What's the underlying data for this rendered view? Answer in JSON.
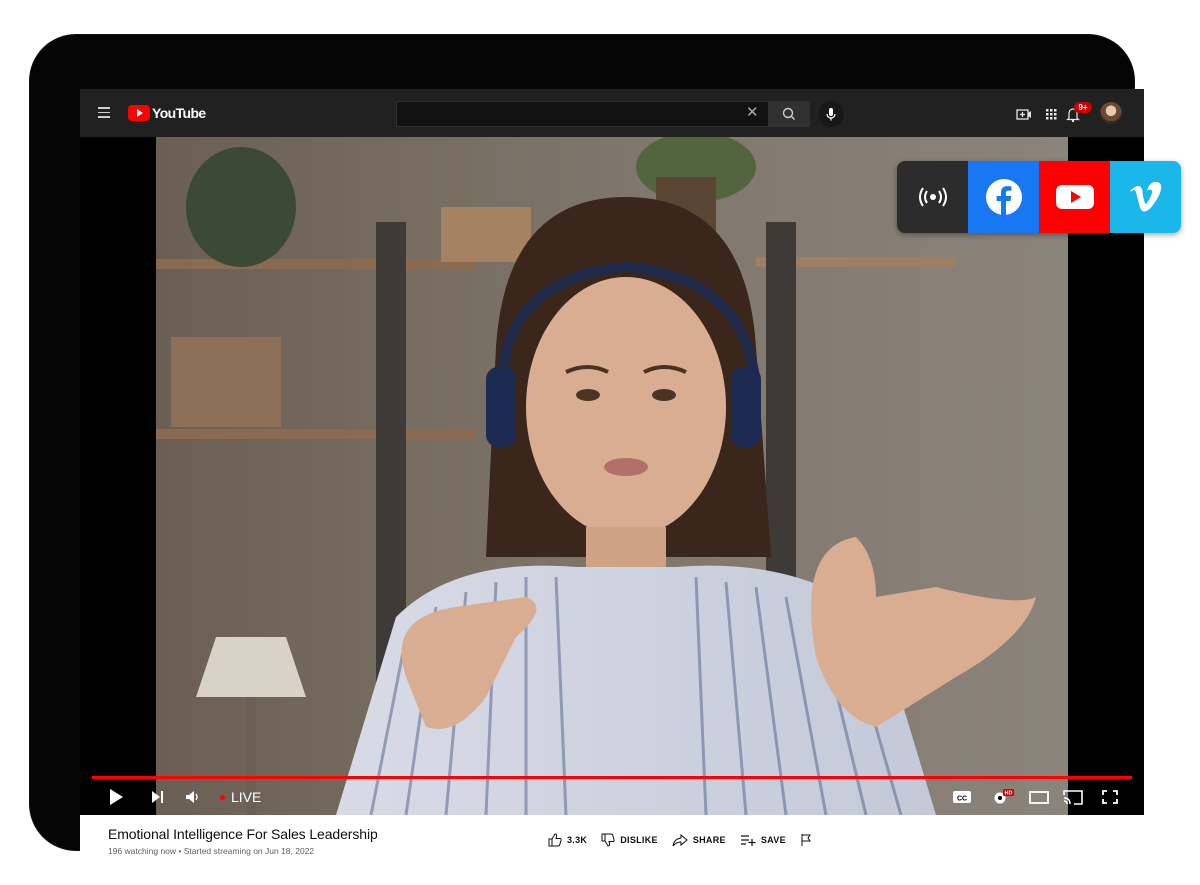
{
  "header": {
    "logo_text": "YouTube",
    "search": {
      "value": "",
      "placeholder": ""
    },
    "notifications_badge": "9+"
  },
  "destinations": [
    "live-broadcast-icon",
    "facebook-icon",
    "youtube-icon",
    "vimeo-icon"
  ],
  "player": {
    "live_label": "LIVE",
    "progress": 1.0,
    "colors": {
      "progress": "#ff0000",
      "live_dot": "#ff0000"
    }
  },
  "video": {
    "title": "Emotional Intelligence For Sales Leadership",
    "meta": "196 watching now • Started streaming on Jun 18, 2022"
  },
  "actions": {
    "like_count": "3.3K",
    "dislike_label": "DISLIKE",
    "share_label": "SHARE",
    "save_label": "SAVE"
  },
  "colors": {
    "brand_red": "#ff0000",
    "facebook": "#1877f2",
    "vimeo": "#1ab7ea",
    "header_bg": "#212121"
  }
}
